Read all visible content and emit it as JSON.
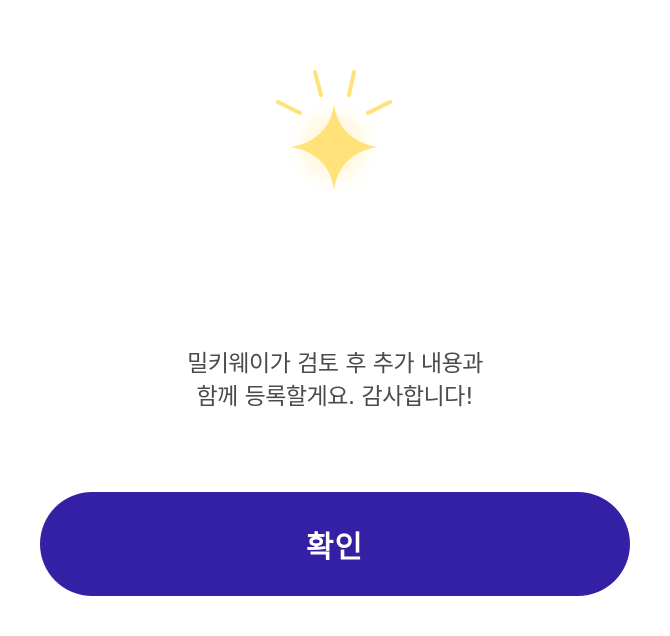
{
  "illustration": {
    "icon": "sparkle-icon",
    "color": "#FFE27A"
  },
  "message": {
    "line1": "밀키웨이가 검토 후 추가 내용과",
    "line2": "함께 등록할게요. 감사합니다!"
  },
  "confirm_button": {
    "label": "확인",
    "color": "#3420A4"
  }
}
